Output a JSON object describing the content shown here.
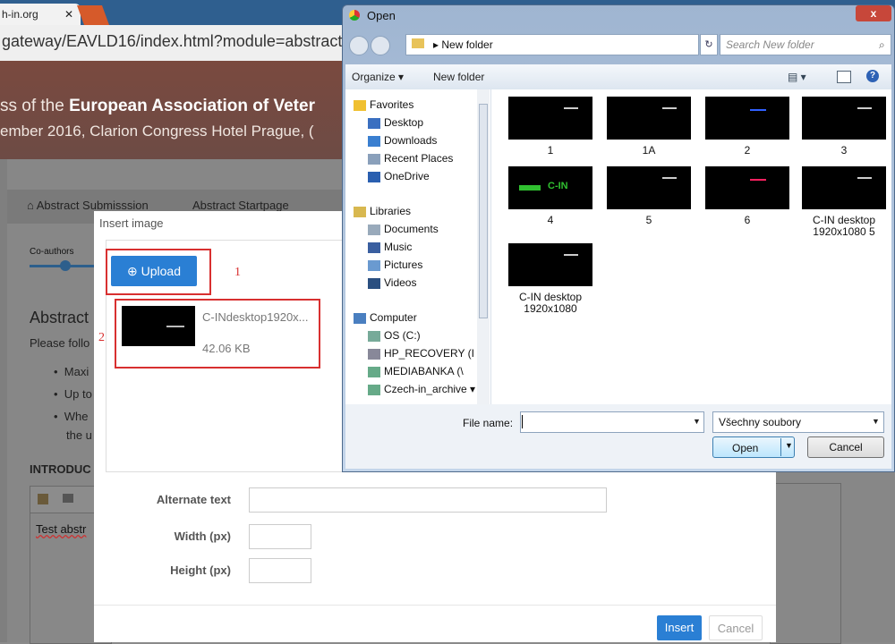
{
  "browser": {
    "tab_title": "h-in.org",
    "tab_close": "✕",
    "url": "gateway/EAVLD16/index.html?module=abstractsub"
  },
  "page": {
    "banner_line1_pre": "ss of the ",
    "banner_line1_bold": "European Association of Veter",
    "banner_line2": "ember 2016, Clarion Congress Hotel Prague, (",
    "breadcrumb": [
      "Abstract Submisssion",
      "Abstract Startpage"
    ],
    "progress_label": "Co-authors",
    "abstract_heading": "Abstract",
    "follow_text": "Please follo",
    "bullets": [
      "Maxi",
      "Up to",
      "Whe",
      "the u"
    ],
    "intro_heading": "INTRODUC",
    "editor_text": "Test abstr"
  },
  "insert_dialog": {
    "title": "Insert image",
    "upload_label": "Upload",
    "annotation_1": "1",
    "annotation_2": "2",
    "file_name": "C-INdesktop1920x...",
    "file_size": "42.06 KB",
    "alt_label": "Alternate text",
    "width_label": "Width (px)",
    "height_label": "Height (px)",
    "insert_label": "Insert",
    "cancel_label": "Cancel"
  },
  "open_dialog": {
    "title": "Open",
    "close": "x",
    "path_crumb": "▸ New folder",
    "search_placeholder": "Search New folder",
    "toolbar": {
      "organize": "Organize ▾",
      "new_folder": "New folder",
      "views": "▤ ▾",
      "help": "?"
    },
    "nav": [
      {
        "label": "Favorites",
        "icon": "star-icon",
        "indent": false,
        "color": "#f0c030"
      },
      {
        "label": "Desktop",
        "icon": "desktop-icon",
        "indent": true,
        "color": "#3a6fc0"
      },
      {
        "label": "Downloads",
        "icon": "downloads-icon",
        "indent": true,
        "color": "#3a7fd0"
      },
      {
        "label": "Recent Places",
        "icon": "recent-places-icon",
        "indent": true,
        "color": "#8aa0bb"
      },
      {
        "label": "OneDrive",
        "icon": "onedrive-icon",
        "indent": true,
        "color": "#2a5fb0"
      },
      {
        "label": "Libraries",
        "icon": "libraries-icon",
        "indent": false,
        "color": "#d8b850"
      },
      {
        "label": "Documents",
        "icon": "documents-icon",
        "indent": true,
        "color": "#9ab"
      },
      {
        "label": "Music",
        "icon": "music-icon",
        "indent": true,
        "color": "#3a5fa0"
      },
      {
        "label": "Pictures",
        "icon": "pictures-icon",
        "indent": true,
        "color": "#6a9ad0"
      },
      {
        "label": "Videos",
        "icon": "videos-icon",
        "indent": true,
        "color": "#2a4f80"
      },
      {
        "label": "Computer",
        "icon": "computer-icon",
        "indent": false,
        "color": "#4a7fc0"
      },
      {
        "label": "OS (C:)",
        "icon": "drive-icon",
        "indent": true,
        "color": "#7a9"
      },
      {
        "label": "HP_RECOVERY (I",
        "icon": "drive-icon",
        "indent": true,
        "color": "#889"
      },
      {
        "label": "MEDIABANKA (\\",
        "icon": "network-drive-icon",
        "indent": true,
        "color": "#6a8"
      },
      {
        "label": "Czech-in_archive ▾",
        "icon": "network-drive-icon",
        "indent": true,
        "color": "#6a8"
      }
    ],
    "files": [
      {
        "name": "1",
        "arrow_color": "#cccccc"
      },
      {
        "name": "1A",
        "arrow_color": "#cccccc"
      },
      {
        "name": "2",
        "arrow_color": "#3060ff"
      },
      {
        "name": "3",
        "arrow_color": "#cccccc"
      },
      {
        "name": "4",
        "arrow_color": "#30c030"
      },
      {
        "name": "5",
        "arrow_color": "#cccccc"
      },
      {
        "name": "6",
        "arrow_color": "#ff2060"
      },
      {
        "name": "C-IN desktop 1920x1080 5",
        "arrow_color": "#cccccc"
      },
      {
        "name": "C-IN desktop 1920x1080",
        "arrow_color": "#cccccc"
      }
    ],
    "thumb4_text": "C-IN",
    "filename_label": "File name:",
    "filename_value": "",
    "filter_value": "Všechny soubory",
    "open_label": "Open",
    "cancel_label": "Cancel"
  }
}
